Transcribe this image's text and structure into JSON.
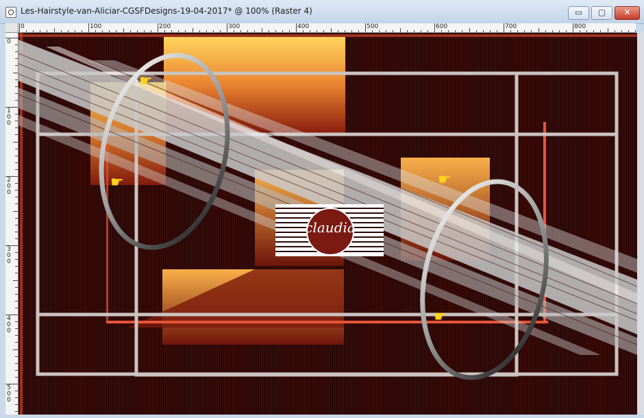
{
  "window": {
    "title": "Les-Hairstyle-van-Aliciar-CGSFDesigns-19-04-2017* @ 100% (Raster 4)",
    "minimize_glyph": "▭",
    "maximize_glyph": "▢",
    "close_glyph": "✕"
  },
  "ruler": {
    "top_labels": [
      "0",
      "100",
      "200",
      "300",
      "400",
      "500",
      "600",
      "700",
      "800"
    ],
    "left_labels": [
      "0",
      "100",
      "200",
      "300",
      "400",
      "500"
    ]
  },
  "canvas": {
    "watermark_text": "claudia",
    "colors": {
      "background": "#2a0705",
      "orange_light": "#ffd15a",
      "orange_dark": "#c3401d",
      "frame": "#cfc7c4",
      "accent_line": "#e8553a"
    }
  },
  "icons": [
    "pointing-hand-icon",
    "pointing-hand-icon",
    "pointing-hand-icon",
    "pointing-hand-icon"
  ]
}
